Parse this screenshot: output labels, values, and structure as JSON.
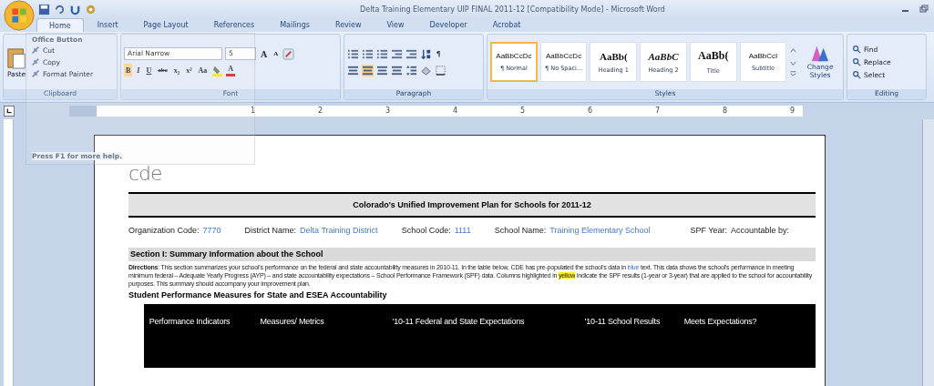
{
  "window": {
    "title": "Delta Training Elementary UIP FINAL 2011-12 [Compatibility Mode] - Microsoft Word"
  },
  "tabs": [
    {
      "label": "Home",
      "selected": true
    },
    {
      "label": "Insert",
      "selected": false
    },
    {
      "label": "Page Layout",
      "selected": false
    },
    {
      "label": "References",
      "selected": false
    },
    {
      "label": "Mailings",
      "selected": false
    },
    {
      "label": "Review",
      "selected": false
    },
    {
      "label": "View",
      "selected": false
    },
    {
      "label": "Developer",
      "selected": false
    },
    {
      "label": "Acrobat",
      "selected": false
    }
  ],
  "tooltip": {
    "title": "Office Button",
    "help": "Press F1 for more help."
  },
  "clipboard": {
    "paste": "Paste",
    "items": [
      "Cut",
      "Copy",
      "Format Painter"
    ],
    "label": "Clipboard"
  },
  "font": {
    "name": "Arial Narrow",
    "size": "5",
    "grow": "A",
    "shrink": "A",
    "buttons": [
      "B",
      "I",
      "U",
      "abc",
      "x₂",
      "x²",
      "Aa"
    ],
    "color_button": "A",
    "label": "Font"
  },
  "paragraph": {
    "pilcrow": "¶",
    "label": "Paragraph"
  },
  "styles": {
    "items": [
      {
        "sample": "AaBbCcDc",
        "name": "¶ Normal",
        "kind": "plain",
        "selected": true
      },
      {
        "sample": "AaBbCcDc",
        "name": "¶ No Spaci...",
        "kind": "plain",
        "selected": false
      },
      {
        "sample": "AaBb(",
        "name": "Heading 1",
        "kind": "heading",
        "selected": false
      },
      {
        "sample": "AaBbC",
        "name": "Heading 2",
        "kind": "italic",
        "selected": false
      },
      {
        "sample": "AaBb(",
        "name": "Title",
        "kind": "title",
        "selected": false
      },
      {
        "sample": "AaBbCcI",
        "name": "Subtitle",
        "kind": "plain",
        "selected": false
      }
    ],
    "change": "Change Styles",
    "label": "Styles"
  },
  "editing": {
    "items": [
      "Find",
      "Replace",
      "Select"
    ],
    "label": "Editing"
  },
  "ruler": [
    "1",
    "2",
    "3",
    "4",
    "5",
    "6",
    "7",
    "8",
    "9"
  ],
  "document": {
    "logo": "cde",
    "title": "Colorado's Unified Improvement Plan for Schools for 2011-12",
    "fields": [
      {
        "label": "Organization Code:",
        "value": "7770"
      },
      {
        "label": "District Name:",
        "value": "Delta Training District"
      },
      {
        "label": "School Code:",
        "value": "1111"
      },
      {
        "label": "School Name:",
        "value": "Training Elementary School"
      },
      {
        "label": "SPF Year:"
      },
      {
        "label": "Accountable by:"
      }
    ],
    "section": "Section I:  Summary Information about the School",
    "directions": [
      {
        "kind": "plain",
        "text": "**Directions**:  This section summarizes your school's performance on the federal and state accountability measures in 2010-11.  In the table below, CDE has pre-populated the school's data in "
      },
      {
        "kind": "blue",
        "text": "blue"
      },
      {
        "kind": "plain",
        "text": " text.  This data shows the school's performance in meeting minimum federal – Adequate Yearly Progress (AYP) – and state accountability expectations – School Performance Framework (SPF) data. Columns highlighted in "
      },
      {
        "kind": "highlight",
        "text": "yellow"
      },
      {
        "kind": "plain",
        "text": " indicate the SPF results (1-year or 3-year) that are applied to the school for accountability purposes.  This summary should accompany your improvement plan."
      }
    ],
    "subheading": "Student Performance Measures for State and ESEA Accountability",
    "columns": [
      "Performance Indicators",
      "Measures/ Metrics",
      "'10-11 Federal and State Expectations",
      "'10-11 School Results",
      "Meets Expectations?"
    ]
  }
}
